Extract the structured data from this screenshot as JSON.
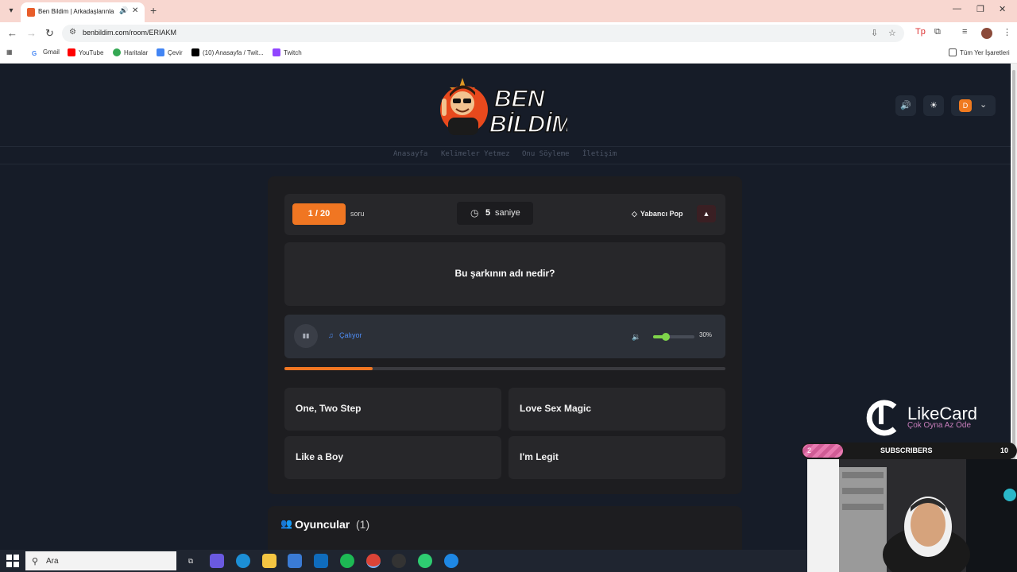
{
  "browser": {
    "tab_title": "Ben Bildim | Arkadaşlarınla",
    "url": "benbildim.com/room/ERIAKM",
    "bookmarks": [
      "Gmail",
      "YouTube",
      "Haritalar",
      "Çevir",
      "(10) Anasayfa / Twit...",
      "Twitch"
    ],
    "all_bookmarks": "Tüm Yer İşaretleri"
  },
  "site": {
    "logo_line1": "BEN",
    "logo_line2": "BİLDİM",
    "user_initial": "D",
    "nav": [
      "Anasayfa",
      "Kelimeler Yetmez",
      "Onu Söyleme",
      "İletişim"
    ]
  },
  "game": {
    "question_counter": "1 / 20",
    "question_word": "soru",
    "timer_value": "5",
    "timer_unit": "saniye",
    "category": "Yabancı Pop",
    "question_text": "Bu şarkının adı nedir?",
    "playing_label": "Çalıyor",
    "volume_label": "30%",
    "volume_level": 0.3,
    "progress_fraction": 0.2,
    "answers": [
      "One, Two Step",
      "Love Sex Magic",
      "Like a Boy",
      "I'm Legit"
    ],
    "players_title": "Oyuncular",
    "players_count": "(1)"
  },
  "overlay": {
    "brand": "LikeCard",
    "slogan": "Çok Oyna  Az Öde",
    "sub_current": "2",
    "sub_label": "SUBSCRIBERS",
    "sub_goal": "10"
  },
  "taskbar": {
    "search_placeholder": "Ara"
  },
  "colors": {
    "accent": "#f07622",
    "volume": "#7fd44a",
    "link": "#4f8df5"
  }
}
